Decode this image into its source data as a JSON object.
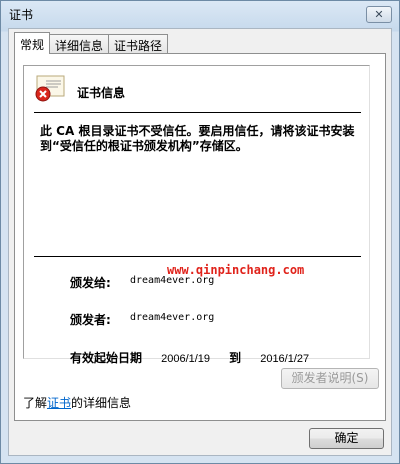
{
  "window": {
    "title": "证书",
    "close_glyph": "✕"
  },
  "tabs": [
    {
      "label": "常规",
      "active": true
    },
    {
      "label": "详细信息",
      "active": false
    },
    {
      "label": "证书路径",
      "active": false
    }
  ],
  "certificate": {
    "icon": "certificate-error-icon",
    "heading": "证书信息",
    "warning": "此 CA 根目录证书不受信任。要启用信任，请将该证书安装到“受信任的根证书颁发机构”存储区。",
    "issued_to_label": "颁发给:",
    "issued_to_value": "dream4ever.org",
    "issued_by_label": "颁发者:",
    "issued_by_value": "dream4ever.org",
    "valid_label": "有效起始日期",
    "valid_from": "2006/1/19",
    "valid_to_label": "到",
    "valid_to": "2016/1/27"
  },
  "watermark": "www.qinpinchang.com",
  "issuer_statement_button": "颁发者说明(S)",
  "learn_more": {
    "prefix": "了解",
    "link": "证书",
    "suffix": "的详细信息"
  },
  "ok_button": "确定",
  "colors": {
    "link": "#0066cc",
    "watermark": "#e0231b",
    "error_badge": "#d9261c"
  }
}
